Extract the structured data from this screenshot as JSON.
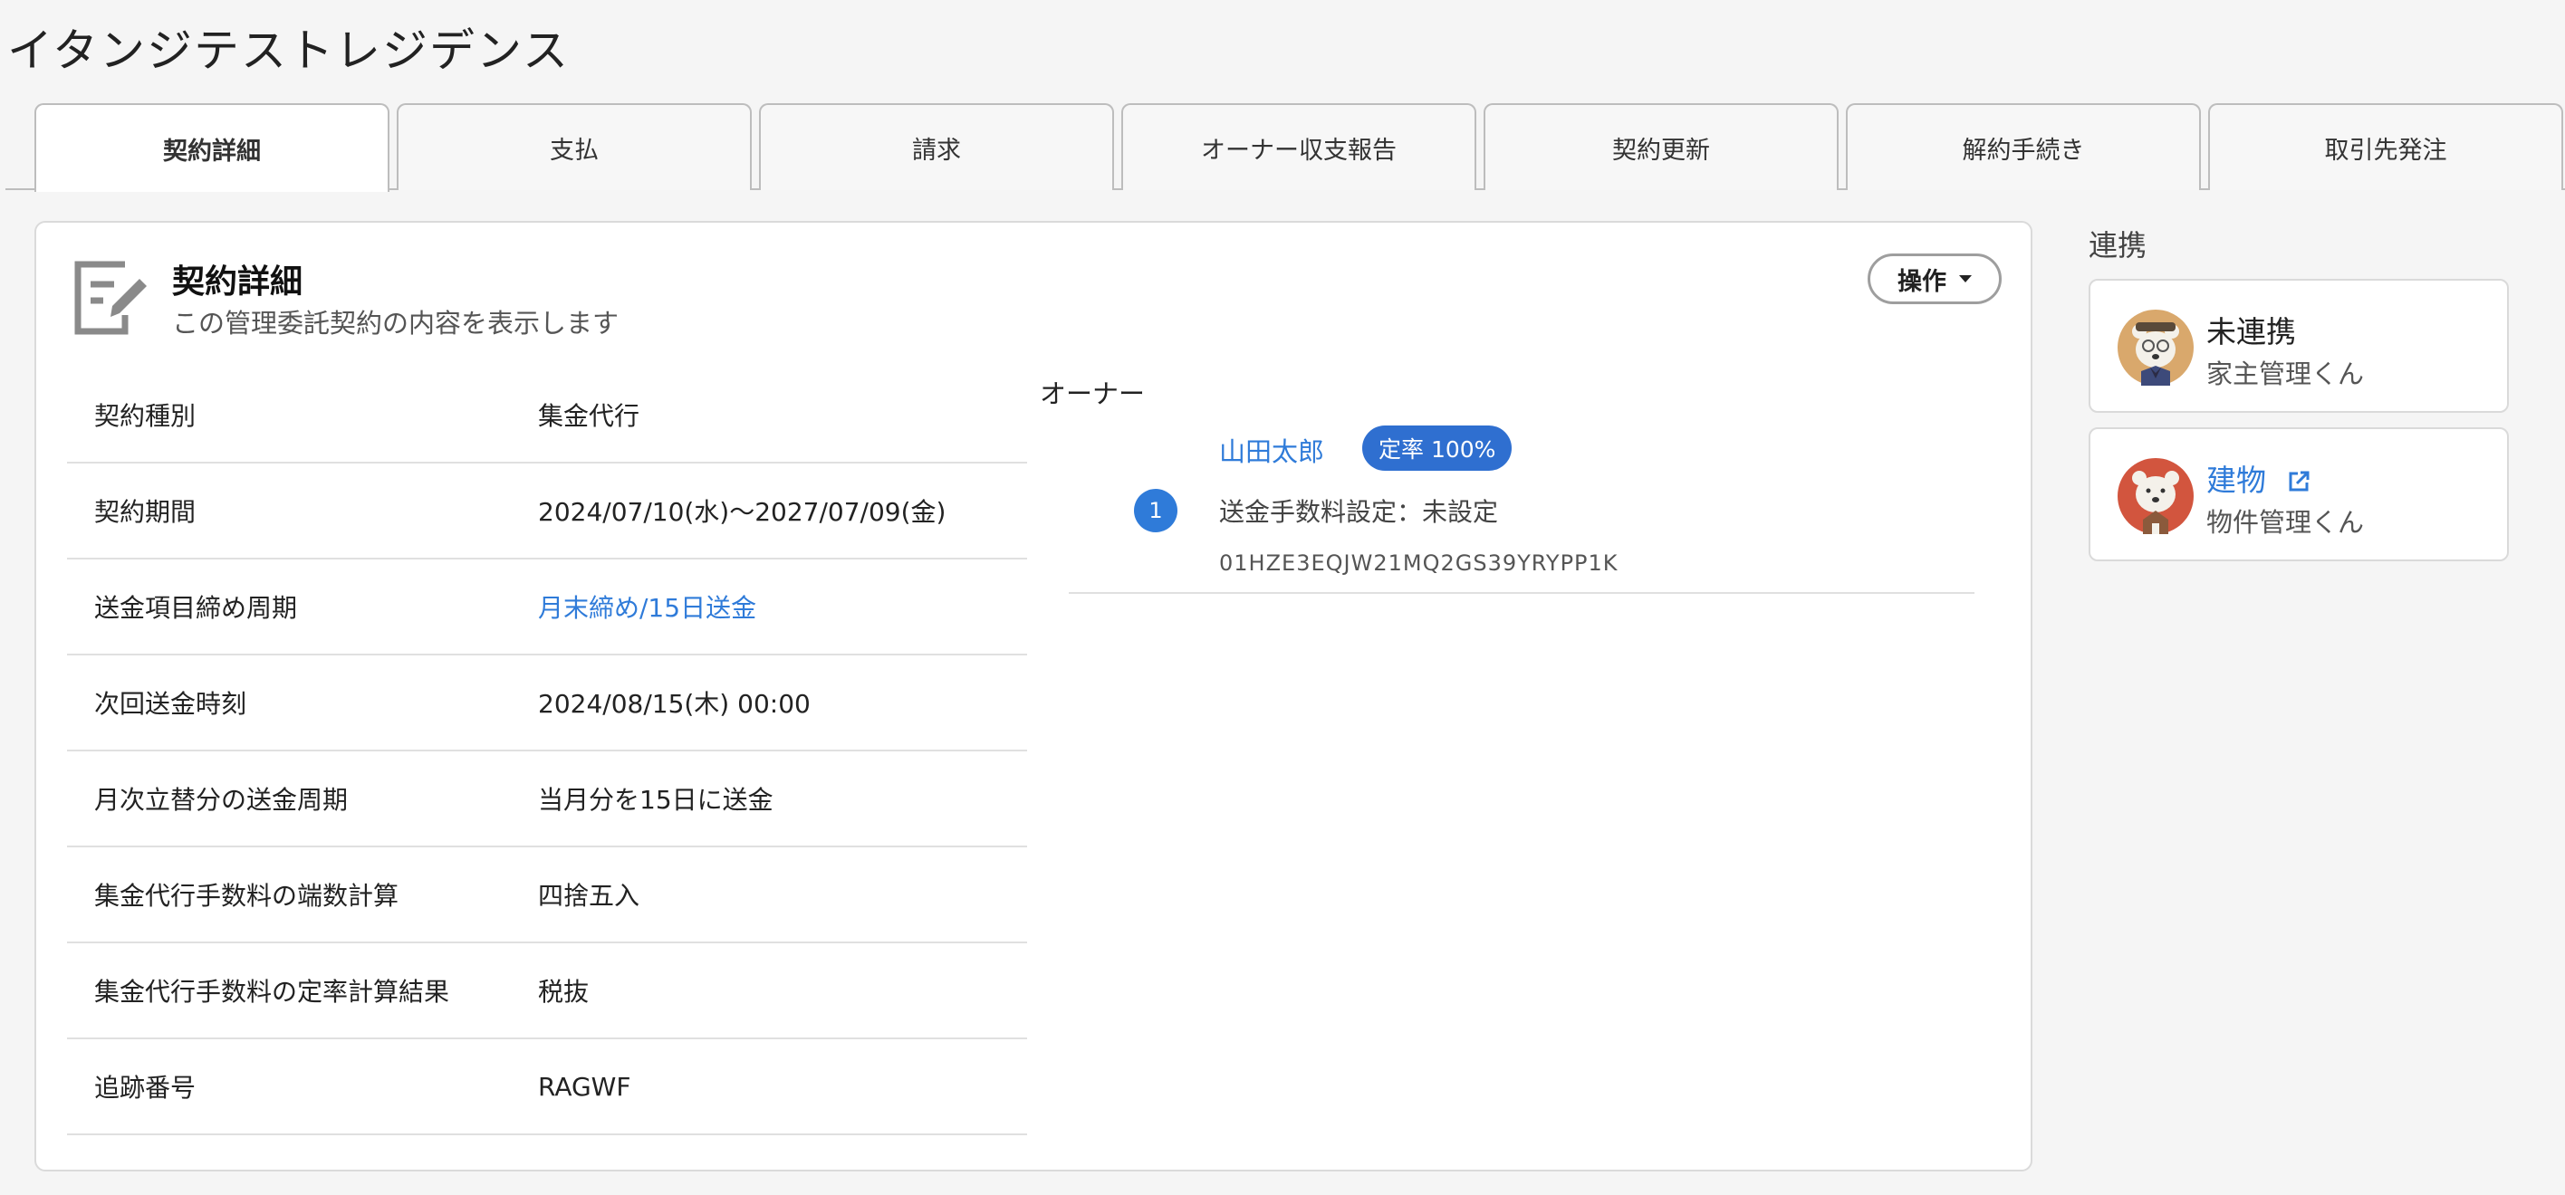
{
  "page": {
    "title": "イタンジテストレジデンス"
  },
  "tabs": [
    {
      "label": "契約詳細",
      "active": true
    },
    {
      "label": "支払"
    },
    {
      "label": "請求"
    },
    {
      "label": "オーナー収支報告"
    },
    {
      "label": "契約更新"
    },
    {
      "label": "解約手続き"
    },
    {
      "label": "取引先発注"
    }
  ],
  "section": {
    "title": "契約詳細",
    "subtitle": "この管理委託契約の内容を表示します",
    "icon": "edit-document-icon",
    "operation_label": "操作"
  },
  "details": [
    {
      "label": "契約種別",
      "value": "集金代行"
    },
    {
      "label": "契約期間",
      "value": "2024/07/10(水)～2027/07/09(金)"
    },
    {
      "label": "送金項目締め周期",
      "value": "月末締め/15日送金",
      "link": true
    },
    {
      "label": "次回送金時刻",
      "value": "2024/08/15(木) 00:00"
    },
    {
      "label": "月次立替分の送金周期",
      "value": "当月分を15日に送金"
    },
    {
      "label": "集金代行手数料の端数計算",
      "value": "四捨五入"
    },
    {
      "label": "集金代行手数料の定率計算結果",
      "value": "税抜"
    },
    {
      "label": "追跡番号",
      "value": "RAGWF"
    }
  ],
  "owner": {
    "heading": "オーナー",
    "number": "1",
    "name": "山田太郎",
    "rate_badge": "定率 100%",
    "fee_setting": "送金手数料設定：未設定",
    "id": "01HZE3EQJW21MQ2GS39YRYPP1K"
  },
  "integrations": {
    "title": "連携",
    "items": [
      {
        "name": "未連携",
        "service": "家主管理くん",
        "icon": "bear-avatar-icon"
      },
      {
        "name": "建物",
        "service": "物件管理くん",
        "icon": "bear-avatar-icon",
        "external_icon": "external-link-icon"
      }
    ]
  },
  "colors": {
    "link": "#2f7bd9",
    "badge": "#2f6fd0",
    "avatar1_bg": "#d9a86c",
    "avatar2_bg": "#d2553e"
  }
}
